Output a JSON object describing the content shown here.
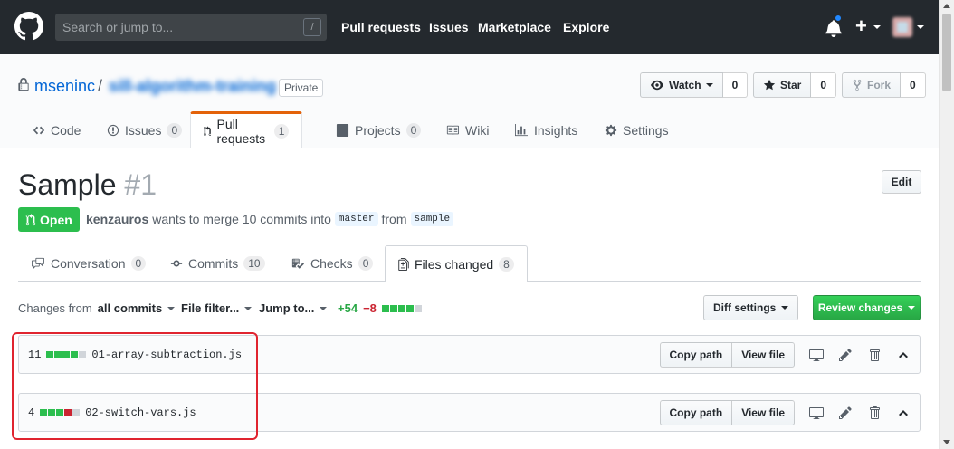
{
  "header": {
    "search_placeholder": "Search or jump to...",
    "search_shortcut": "/",
    "nav": [
      "Pull requests",
      "Issues",
      "Marketplace",
      "Explore"
    ]
  },
  "repo": {
    "owner": "mseninc",
    "separator": "/",
    "name": "sill-algorithm-training",
    "visibility": "Private",
    "watch_label": "Watch",
    "watch_count": "0",
    "star_label": "Star",
    "star_count": "0",
    "fork_label": "Fork",
    "fork_count": "0",
    "tabs": {
      "code": "Code",
      "issues": "Issues",
      "issues_count": "0",
      "pulls": "Pull requests",
      "pulls_count": "1",
      "projects": "Projects",
      "projects_count": "0",
      "wiki": "Wiki",
      "insights": "Insights",
      "settings": "Settings"
    }
  },
  "pr": {
    "title": "Sample",
    "number": "#1",
    "edit_label": "Edit",
    "state": "Open",
    "author": "kenzauros",
    "merge_text": "wants to merge 10 commits into",
    "base_branch": "master",
    "from_text": "from",
    "head_branch": "sample",
    "tabs": {
      "conversation": "Conversation",
      "conversation_count": "0",
      "commits": "Commits",
      "commits_count": "10",
      "checks": "Checks",
      "checks_count": "0",
      "files": "Files changed",
      "files_count": "8"
    }
  },
  "toolbar": {
    "changes_from": "Changes from",
    "all_commits": "all commits",
    "file_filter": "File filter...",
    "jump_to": "Jump to...",
    "additions": "+54",
    "deletions": "−8",
    "diff_settings": "Diff settings",
    "review_changes": "Review changes"
  },
  "files": [
    {
      "count": "11",
      "name": "01-array-subtraction.js",
      "stat": [
        "g",
        "g",
        "g",
        "g",
        "n"
      ]
    },
    {
      "count": "4",
      "name": "02-switch-vars.js",
      "stat": [
        "g",
        "g",
        "g",
        "r",
        "n"
      ]
    }
  ],
  "file_actions": {
    "copy_path": "Copy path",
    "view_file": "View file"
  },
  "colors": {
    "header_bg": "#24292e",
    "accent_blue": "#0366d6",
    "open_green": "#2cbe4e",
    "selected_tab_orange": "#e36209",
    "annotation_red": "#e0242f"
  }
}
